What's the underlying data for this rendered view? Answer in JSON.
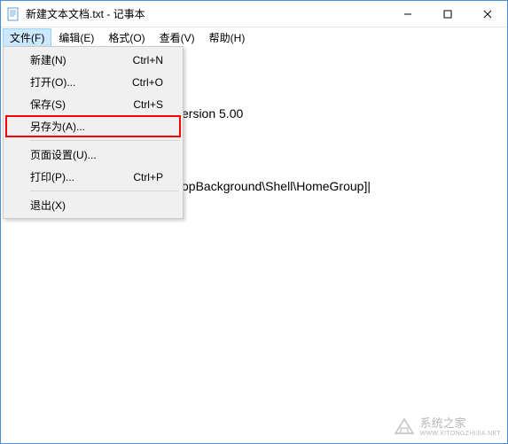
{
  "window": {
    "title": "新建文本文档.txt - 记事本"
  },
  "menubar": {
    "file": "文件(F)",
    "edit": "编辑(E)",
    "format": "格式(O)",
    "view": "查看(V)",
    "help": "帮助(H)"
  },
  "dropdown": {
    "new": {
      "label": "新建(N)",
      "shortcut": "Ctrl+N"
    },
    "open": {
      "label": "打开(O)...",
      "shortcut": "Ctrl+O"
    },
    "save": {
      "label": "保存(S)",
      "shortcut": "Ctrl+S"
    },
    "saveas": {
      "label": "另存为(A)...",
      "shortcut": ""
    },
    "pagesetup": {
      "label": "页面设置(U)...",
      "shortcut": ""
    },
    "print": {
      "label": "打印(P)...",
      "shortcut": "Ctrl+P"
    },
    "exit": {
      "label": "退出(X)",
      "shortcut": ""
    }
  },
  "content": {
    "line1": "ersion 5.00",
    "line2": "",
    "line3": "opBackground\\Shell\\HomeGroup]|"
  },
  "watermark": {
    "text": "系统之家",
    "url": "WWW.XITONGZHIJIA.NET"
  }
}
